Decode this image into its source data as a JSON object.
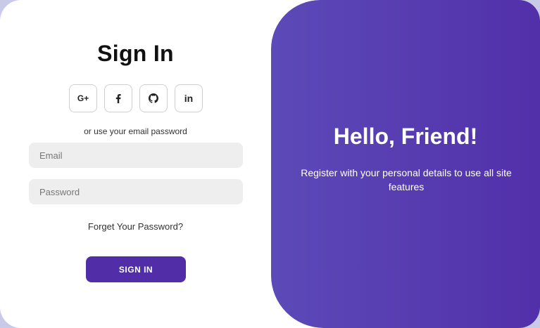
{
  "sign_in": {
    "title": "Sign In",
    "social_buttons": [
      {
        "label": "G+",
        "icon": "google-plus-icon"
      },
      {
        "label": "",
        "icon": "facebook-icon"
      },
      {
        "label": "",
        "icon": "github-icon"
      },
      {
        "label": "in",
        "icon": "linkedin-icon"
      }
    ],
    "or_text": "or use your email password",
    "email_placeholder": "Email",
    "password_placeholder": "Password",
    "forgot_label": "Forget Your Password?",
    "button_label": "SIGN IN"
  },
  "panel": {
    "title": "Hello, Friend!",
    "text": "Register with your personal details to use all site features"
  },
  "colors": {
    "accent": "#512da8",
    "panel_gradient_start": "#5c4ab8",
    "panel_gradient_end": "#512da8",
    "input_bg": "#eeeeee"
  }
}
